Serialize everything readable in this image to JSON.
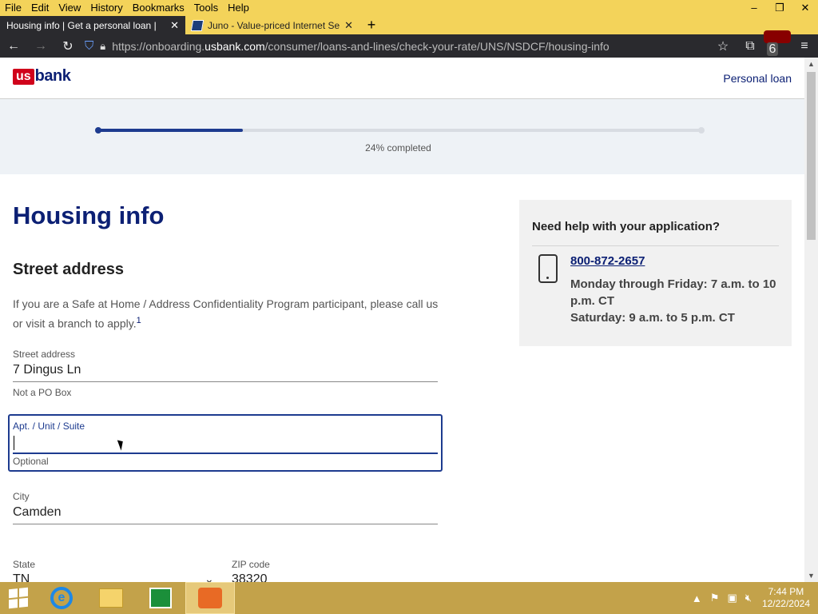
{
  "menubar": {
    "items": [
      "File",
      "Edit",
      "View",
      "History",
      "Bookmarks",
      "Tools",
      "Help"
    ]
  },
  "window_controls": {
    "minimize": "–",
    "restore": "❐",
    "close": "✕"
  },
  "tabs": [
    {
      "title": "Housing info | Get a personal loan |"
    },
    {
      "title": "Juno - Value-priced Internet Ser"
    }
  ],
  "navbar": {
    "url_prefix": "https://onboarding.",
    "url_domain": "usbank.com",
    "url_path": "/consumer/loans-and-lines/check-your-rate/UNS/NSDCF/housing-info",
    "extension_badge": "6"
  },
  "site": {
    "logo_us": "us",
    "logo_bank": "bank",
    "product_link": "Personal loan"
  },
  "progress": {
    "percent": 24,
    "label": "24% completed"
  },
  "form": {
    "title": "Housing info",
    "section": "Street address",
    "note": "If you are a Safe at Home / Address Confidentiality Program participant, please call us or visit a branch to apply.",
    "note_footnote": "1",
    "street": {
      "label": "Street address",
      "value": "7 Dingus Ln",
      "helper": "Not a PO Box"
    },
    "apt": {
      "label": "Apt. / Unit / Suite",
      "value": "",
      "helper": "Optional"
    },
    "city": {
      "label": "City",
      "value": "Camden"
    },
    "state": {
      "label": "State",
      "value": "TN"
    },
    "zip": {
      "label": "ZIP code",
      "value": "38320"
    }
  },
  "help": {
    "title": "Need help with your application?",
    "phone": "800-872-2657",
    "hours_weekday": "Monday through Friday: 7 a.m. to 10 p.m. CT",
    "hours_saturday": "Saturday: 9 a.m. to 5 p.m. CT"
  },
  "taskbar": {
    "time": "7:44 PM",
    "date": "12/22/2024"
  },
  "colors": {
    "brand_navy": "#0c2074",
    "brand_red": "#d0021b",
    "progress_fill": "#1d3b8f",
    "taskbar": "#c3a24a",
    "firefox_chrome": "#2a2a2e"
  }
}
